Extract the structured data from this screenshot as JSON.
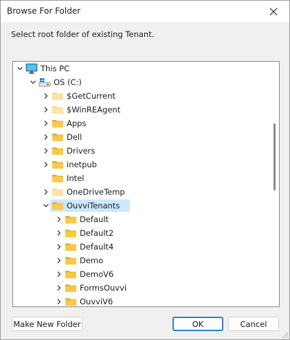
{
  "window": {
    "title": "Browse For Folder",
    "instruction": "Select root folder of existing Tenant."
  },
  "tree": {
    "items": [
      {
        "label": "This PC",
        "level": 0,
        "icon": "monitor-icon",
        "expanded": true,
        "has_children": true
      },
      {
        "label": "OS (C:)",
        "level": 1,
        "icon": "drive-icon",
        "expanded": true,
        "has_children": true
      },
      {
        "label": "$GetCurrent",
        "level": 2,
        "icon": "folder-hidden-icon",
        "expanded": false,
        "has_children": true
      },
      {
        "label": "$WinREAgent",
        "level": 2,
        "icon": "folder-hidden-icon",
        "expanded": false,
        "has_children": true
      },
      {
        "label": "Apps",
        "level": 2,
        "icon": "folder-icon",
        "expanded": false,
        "has_children": true
      },
      {
        "label": "Dell",
        "level": 2,
        "icon": "folder-icon",
        "expanded": false,
        "has_children": true
      },
      {
        "label": "Drivers",
        "level": 2,
        "icon": "folder-icon",
        "expanded": false,
        "has_children": true
      },
      {
        "label": "inetpub",
        "level": 2,
        "icon": "folder-icon",
        "expanded": false,
        "has_children": true
      },
      {
        "label": "Intel",
        "level": 2,
        "icon": "folder-icon",
        "expanded": false,
        "has_children": false
      },
      {
        "label": "OneDriveTemp",
        "level": 2,
        "icon": "folder-hidden-icon",
        "expanded": false,
        "has_children": true
      },
      {
        "label": "OuvviTenants",
        "level": 2,
        "icon": "folder-icon",
        "expanded": true,
        "has_children": true,
        "selected": true
      },
      {
        "label": "Default",
        "level": 3,
        "icon": "folder-icon",
        "expanded": false,
        "has_children": true
      },
      {
        "label": "Default2",
        "level": 3,
        "icon": "folder-icon",
        "expanded": false,
        "has_children": true
      },
      {
        "label": "Default4",
        "level": 3,
        "icon": "folder-icon",
        "expanded": false,
        "has_children": true
      },
      {
        "label": "Demo",
        "level": 3,
        "icon": "folder-icon",
        "expanded": false,
        "has_children": true
      },
      {
        "label": "DemoV6",
        "level": 3,
        "icon": "folder-icon",
        "expanded": false,
        "has_children": true
      },
      {
        "label": "FormsOuvvi",
        "level": 3,
        "icon": "folder-icon",
        "expanded": false,
        "has_children": true
      },
      {
        "label": "OuvviV6",
        "level": 3,
        "icon": "folder-icon",
        "expanded": false,
        "has_children": true
      }
    ]
  },
  "buttons": {
    "make_new_folder": "Make New Folder",
    "ok": "OK",
    "cancel": "Cancel"
  },
  "colors": {
    "folder": "#f8c94a",
    "folder_hidden": "#fbe4a6",
    "selection": "#cce8ff",
    "default_button_border": "#2a7fd4"
  }
}
